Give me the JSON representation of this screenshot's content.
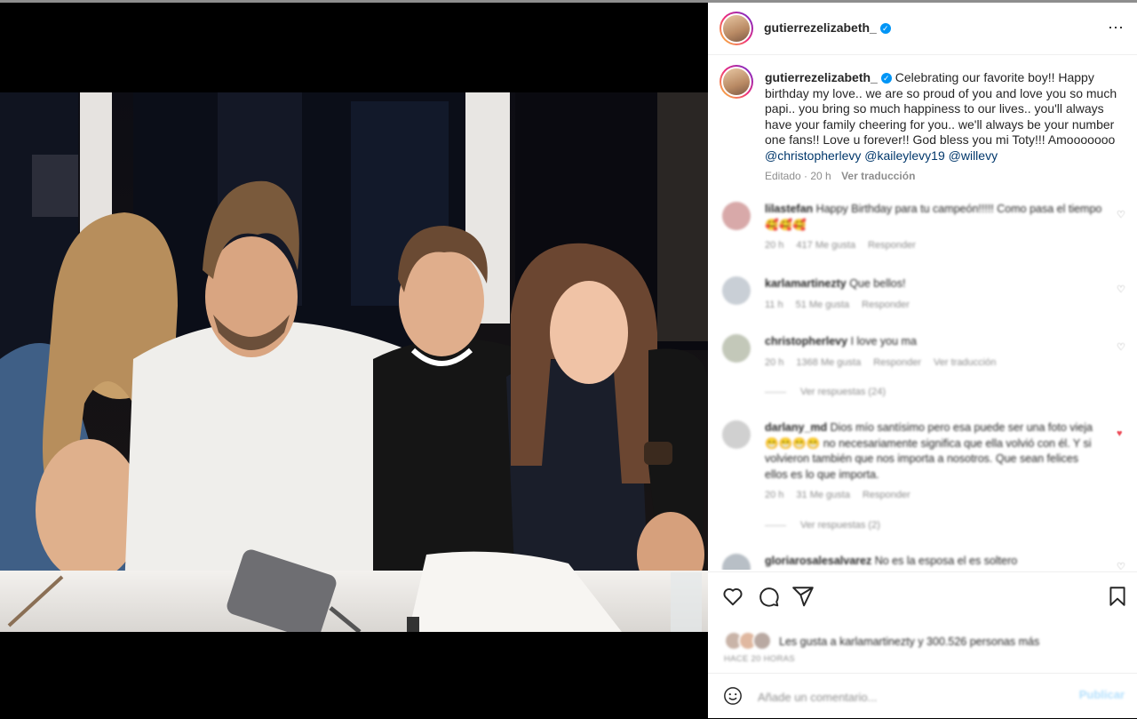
{
  "post": {
    "username": "gutierrezelizabeth_",
    "verified_icon": "verified-badge-icon",
    "more_icon": "⋯"
  },
  "caption": {
    "username": "gutierrezelizabeth_",
    "text": "Celebrating our favorite boy!! Happy birthday my love.. we are so proud of you and love you so much papi.. you bring so much happiness to our lives.. you'll always have your family cheering for you.. we'll always be your number one fans!! Love u forever!! God bless you mi Toty!!! Amooooooo",
    "mentions": [
      "@christopherlevy",
      "@kaileylevy19",
      "@willevy"
    ],
    "edited": "Editado · 20 h",
    "see_translation": "Ver traducción"
  },
  "comments": [
    {
      "username": "lilastefan",
      "text": "Happy Birthday para tu campeón!!!!! Como pasa el tiempo 🥰🥰🥰",
      "time": "20 h",
      "likes": "417 Me gusta",
      "reply": "Responder"
    },
    {
      "username": "karlamartinezty",
      "text": "Que bellos!",
      "time": "11 h",
      "likes": "51 Me gusta",
      "reply": "Responder"
    },
    {
      "username": "christopherlevy",
      "text": "I love you ma",
      "time": "20 h",
      "likes": "1368 Me gusta",
      "reply": "Responder",
      "translate": "Ver traducción",
      "replies": "Ver respuestas (24)"
    },
    {
      "username": "darlany_md",
      "text": "Dios mío santísimo pero esa puede ser una foto vieja 😁😁😁😁 no necesariamente significa que ella volvió con él. Y si volvieron también que nos importa a nosotros. Que sean felices ellos es lo que importa.",
      "time": "20 h",
      "likes": "31 Me gusta",
      "reply": "Responder",
      "replies": "Ver respuestas (2)"
    },
    {
      "username": "gloriarosalesalvarez",
      "text": "No es la esposa el es soltero"
    }
  ],
  "actions": {
    "like_icon": "heart-icon",
    "comment_icon": "comment-icon",
    "share_icon": "share-icon",
    "save_icon": "bookmark-icon"
  },
  "likes": {
    "text": "Les gusta a karlamartinezty y 300.526 personas más"
  },
  "timestamp": "HACE 20 HORAS",
  "add_comment": {
    "placeholder": "Añade un comentario...",
    "post_label": "Publicar"
  },
  "colors": {
    "accent": "#0095f6",
    "link": "#00376b",
    "muted": "#8e8e8e"
  }
}
